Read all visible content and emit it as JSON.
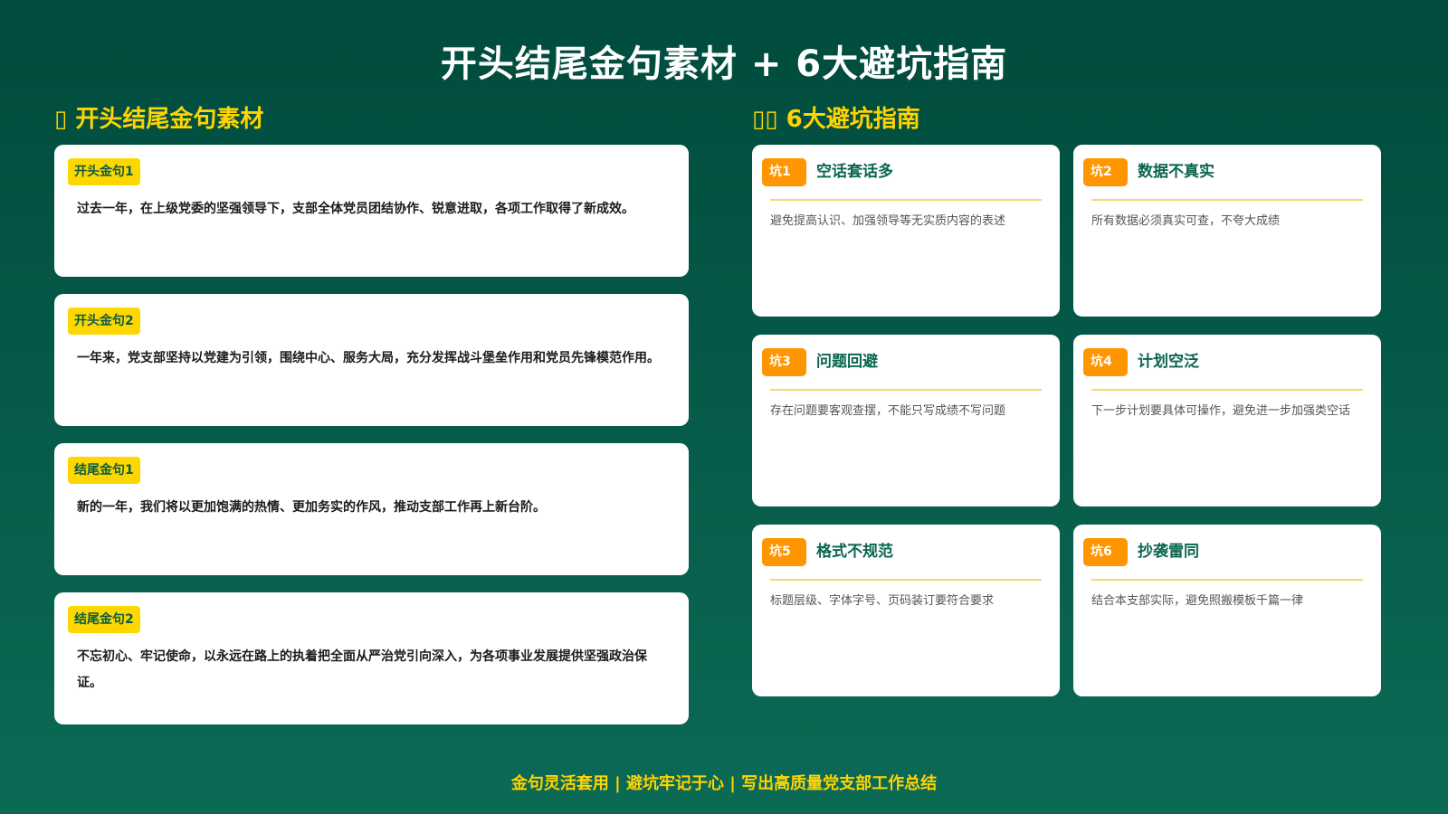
{
  "header": {
    "title": "开头结尾金句素材 + 6大避坑指南"
  },
  "left": {
    "title": "▯ 开头结尾金句素材",
    "quotes": [
      {
        "tag": "开头金句1",
        "text": "过去一年，在上级党委的坚强领导下，支部全体党员团结协作、锐意进取，各项工作取得了新成效。"
      },
      {
        "tag": "开头金句2",
        "text": "一年来，党支部坚持以党建为引领，围绕中心、服务大局，充分发挥战斗堡垒作用和党员先锋模范作用。"
      },
      {
        "tag": "结尾金句1",
        "text": "新的一年，我们将以更加饱满的热情、更加务实的作风，推动支部工作再上新台阶。"
      },
      {
        "tag": "结尾金句2",
        "text": "不忘初心、牢记使命，以永远在路上的执着把全面从严治党引向深入，为各项事业发展提供坚强政治保证。"
      }
    ]
  },
  "right": {
    "title": "▯▯ 6大避坑指南",
    "pits": [
      {
        "badge": "坑1",
        "title": "空话套话多",
        "desc": "避免提高认识、加强领导等无实质内容的表述"
      },
      {
        "badge": "坑2",
        "title": "数据不真实",
        "desc": "所有数据必须真实可查，不夸大成绩"
      },
      {
        "badge": "坑3",
        "title": "问题回避",
        "desc": "存在问题要客观查摆，不能只写成绩不写问题"
      },
      {
        "badge": "坑4",
        "title": "计划空泛",
        "desc": "下一步计划要具体可操作，避免进一步加强类空话"
      },
      {
        "badge": "坑5",
        "title": "格式不规范",
        "desc": "标题层级、字体字号、页码装订要符合要求"
      },
      {
        "badge": "坑6",
        "title": "抄袭雷同",
        "desc": "结合本支部实际，避免照搬模板千篇一律"
      }
    ]
  },
  "footer": {
    "text": "金句灵活套用 | 避坑牢记于心 | 写出高质量党支部工作总结"
  },
  "colors": {
    "background": "#004b3d",
    "accent": "#ffd400",
    "badge": "#ff9500",
    "tag": "#ffd700"
  }
}
